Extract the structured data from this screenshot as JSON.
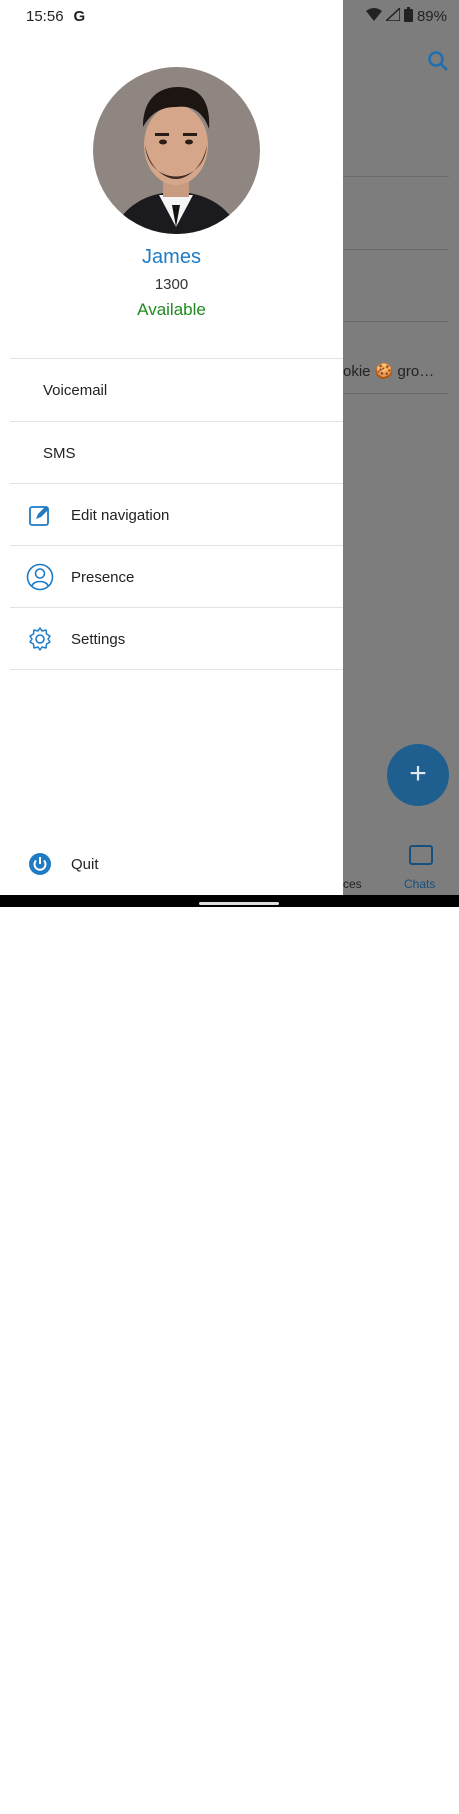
{
  "status_bar": {
    "time": "15:56",
    "battery": "89%"
  },
  "profile": {
    "name": "James",
    "extension": "1300",
    "status": "Available"
  },
  "menu": {
    "voicemail": "Voicemail",
    "sms": "SMS",
    "edit_navigation": "Edit navigation",
    "presence": "Presence",
    "settings": "Settings",
    "quit": "Quit"
  },
  "background": {
    "snippet": "okie 🍪 gro…",
    "tab_partial": "ces",
    "tab_chats": "Chats",
    "fab_label": "+"
  },
  "colors": {
    "accent": "#1e7bc4",
    "available": "#1f8a1f",
    "overlay": "#7d7d7d"
  },
  "icons": [
    "g-icon",
    "wifi-icon",
    "cell-signal-icon",
    "battery-icon",
    "search-icon",
    "edit-icon",
    "person-icon",
    "gear-icon",
    "power-icon",
    "chat-icon"
  ]
}
